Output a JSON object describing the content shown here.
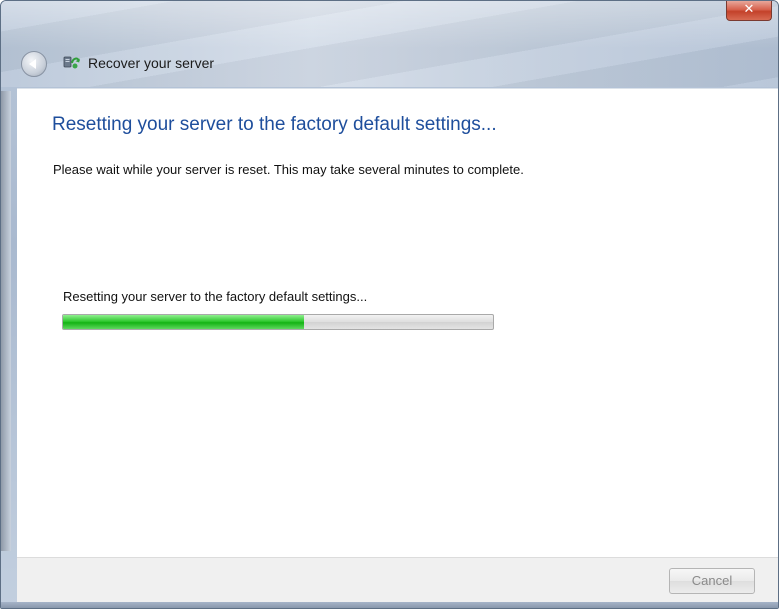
{
  "window": {
    "title": "Recover your server",
    "close_glyph": "✕"
  },
  "main": {
    "heading": "Resetting your server to the factory default settings...",
    "description": "Please wait while your server is reset. This may take several minutes to complete.",
    "progress": {
      "label": "Resetting your server to the factory default settings...",
      "percent": 56,
      "color": "#22c022"
    }
  },
  "footer": {
    "cancel_label": "Cancel",
    "cancel_enabled": false
  },
  "icons": {
    "back": "back-arrow-icon",
    "title": "server-recovery-icon",
    "close": "close-icon"
  },
  "colors": {
    "heading": "#1e4e9c",
    "progress_fill": "#22c022"
  }
}
